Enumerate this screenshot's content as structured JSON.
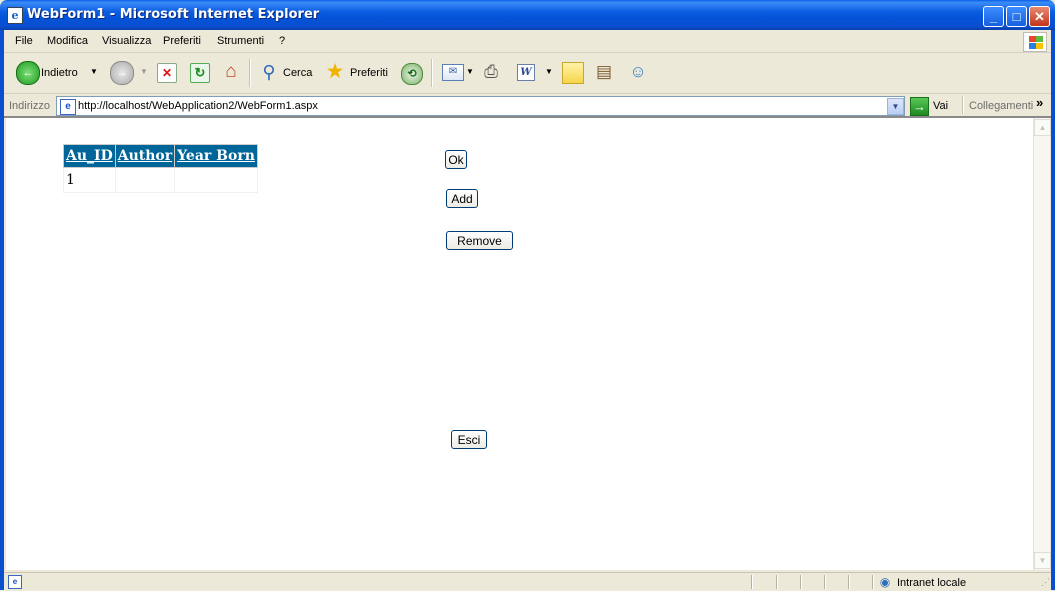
{
  "window": {
    "title": "WebForm1 - Microsoft Internet Explorer",
    "min_glyph": "_",
    "max_glyph": "□",
    "close_glyph": "✕"
  },
  "menu": {
    "items": [
      "File",
      "Modifica",
      "Visualizza",
      "Preferiti",
      "Strumenti",
      "?"
    ]
  },
  "toolbar": {
    "back_label": "Indietro",
    "search_label": "Cerca",
    "favorites_label": "Preferiti",
    "icons": [
      "back-icon",
      "forward-icon",
      "stop-icon",
      "refresh-icon",
      "home-icon",
      "search-icon",
      "favorites-icon",
      "history-icon",
      "mail-icon",
      "print-icon",
      "edit-icon",
      "discuss-icon",
      "research-icon",
      "messenger-icon"
    ]
  },
  "address": {
    "label": "Indirizzo",
    "url": "http://localhost/WebApplication2/WebForm1.aspx",
    "go_label": "Vai",
    "links_label": "Collegamenti",
    "chevron": "»"
  },
  "page": {
    "grid": {
      "columns": [
        "Au_ID",
        "Author",
        "Year Born"
      ],
      "rows": [
        [
          "1",
          "",
          ""
        ]
      ],
      "header_bg": "#006699"
    },
    "buttons": {
      "ok": "Ok",
      "add": "Add",
      "remove": "Remove",
      "esci": "Esci"
    }
  },
  "status": {
    "zone": "Intranet locale"
  },
  "colors": {
    "titlebar": "#0a5ee8",
    "chrome": "#ece9d8",
    "grid_header": "#006699"
  }
}
